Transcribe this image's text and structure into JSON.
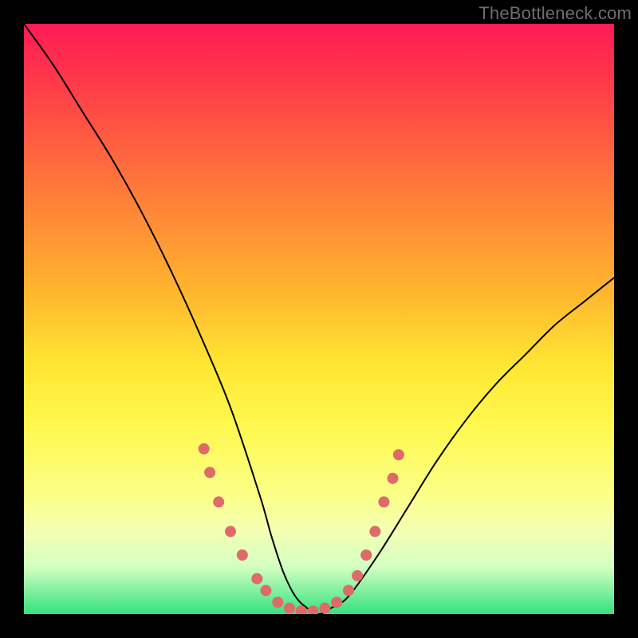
{
  "watermark": "TheBottleneck.com",
  "chart_data": {
    "type": "line",
    "title": "",
    "xlabel": "",
    "ylabel": "",
    "xlim": [
      0,
      100
    ],
    "ylim": [
      0,
      100
    ],
    "grid": false,
    "series": [
      {
        "name": "bottleneck-curve",
        "x": [
          0,
          5,
          10,
          15,
          20,
          25,
          30,
          35,
          40,
          42,
          44,
          46,
          48,
          50,
          52,
          55,
          60,
          65,
          70,
          75,
          80,
          85,
          90,
          95,
          100
        ],
        "y": [
          100,
          93,
          85,
          77,
          68,
          58,
          47,
          35,
          20,
          13,
          7,
          3,
          1,
          0,
          1,
          3,
          10,
          18,
          26,
          33,
          39,
          44,
          49,
          53,
          57
        ],
        "color": "#000000"
      }
    ],
    "threshold_band": {
      "y_range": [
        0,
        18
      ],
      "colors": [
        "#34e17e",
        "#f3ffb4"
      ]
    },
    "markers": {
      "name": "sample-points",
      "color": "#de6a6a",
      "radius_px": 7,
      "points": [
        {
          "x": 30.5,
          "y": 28
        },
        {
          "x": 31.5,
          "y": 24
        },
        {
          "x": 33,
          "y": 19
        },
        {
          "x": 35,
          "y": 14
        },
        {
          "x": 37,
          "y": 10
        },
        {
          "x": 39.5,
          "y": 6
        },
        {
          "x": 41,
          "y": 4
        },
        {
          "x": 43,
          "y": 2
        },
        {
          "x": 45,
          "y": 1
        },
        {
          "x": 47,
          "y": 0.5
        },
        {
          "x": 49,
          "y": 0.5
        },
        {
          "x": 51,
          "y": 1
        },
        {
          "x": 53,
          "y": 2
        },
        {
          "x": 55,
          "y": 4
        },
        {
          "x": 56.5,
          "y": 6.5
        },
        {
          "x": 58,
          "y": 10
        },
        {
          "x": 59.5,
          "y": 14
        },
        {
          "x": 61,
          "y": 19
        },
        {
          "x": 62.5,
          "y": 23
        },
        {
          "x": 63.5,
          "y": 27
        }
      ]
    }
  }
}
